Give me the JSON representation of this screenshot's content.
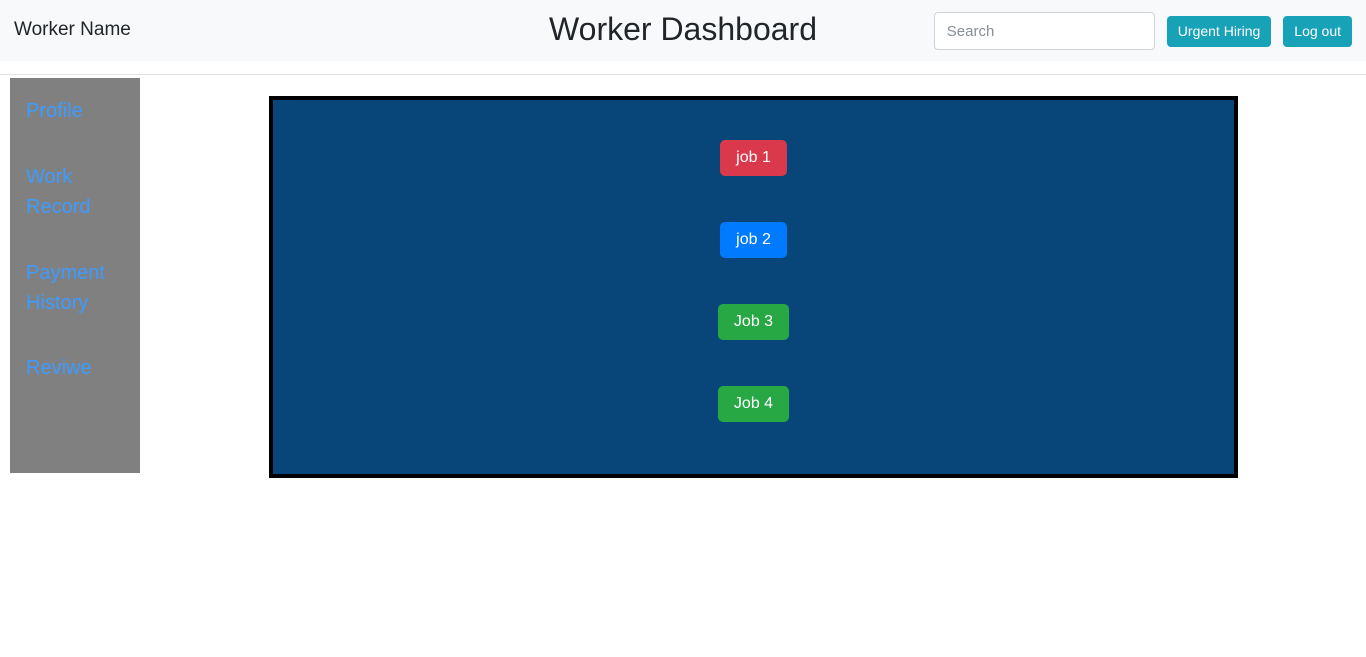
{
  "header": {
    "brand": "Worker Name",
    "title": "Worker Dashboard",
    "search": {
      "placeholder": "Search",
      "value": ""
    },
    "urgent_hiring_label": "Urgent Hiring",
    "logout_label": "Log out",
    "accent_color": "#17a2b8",
    "background_color": "#f8f9fa"
  },
  "sidebar": {
    "background_color": "#808080",
    "link_color": "#3d9bff",
    "items": [
      {
        "label": "Profile"
      },
      {
        "label": "Work Record"
      },
      {
        "label": "Payment History"
      },
      {
        "label": "Reviwe"
      }
    ]
  },
  "main": {
    "panel": {
      "background_color": "#084579",
      "border_color": "#000000"
    },
    "jobs": [
      {
        "label": "job 1",
        "color": "#d9394b",
        "variant": "job-danger"
      },
      {
        "label": "job 2",
        "color": "#007bff",
        "variant": "job-primary"
      },
      {
        "label": "Job 3",
        "color": "#28a745",
        "variant": "job-success"
      },
      {
        "label": "Job 4",
        "color": "#28a745",
        "variant": "job-success"
      }
    ]
  }
}
